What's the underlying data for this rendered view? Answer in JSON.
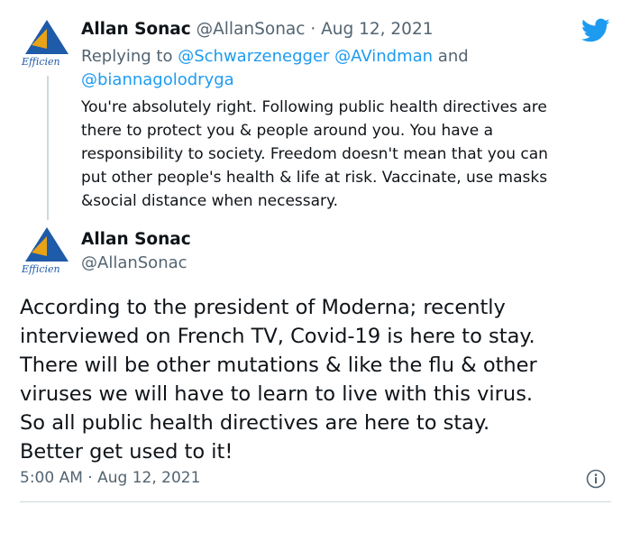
{
  "reply_tweet": {
    "author_name": "Allan Sonac",
    "handle": "@AllanSonac",
    "separator": "·",
    "date": "Aug 12, 2021",
    "replying_prefix": "Replying to",
    "mention_1": "@Schwarzenegger",
    "mention_2": "@AVindman",
    "and_word": "and",
    "mention_3": "@biannagolodryga",
    "text_lines": [
      "You're absolutely right. Following public health directives are",
      "there to protect you & people around you. You have a",
      "responsibility to society. Freedom doesn't mean that you can",
      "put other people's health & life at risk. Vaccinate, use masks",
      "&social distance when necessary."
    ]
  },
  "main_tweet": {
    "author_name": "Allan Sonac",
    "handle": "@AllanSonac",
    "text_lines": [
      "According to the president of Moderna; recently",
      "interviewed on French TV, Covid-19 is here to stay.",
      "There will be other mutations & like the flu & other",
      "viruses we will have to learn to live with this virus.",
      "So all public health directives are here to stay.",
      "Better get used to it!"
    ],
    "time": "5:00 AM",
    "separator": "·",
    "date": "Aug 12, 2021"
  },
  "avatar_logo_text": "Efficiency",
  "twitter_logo": "twitter-bird-icon",
  "info_icon": "info-icon",
  "colors": {
    "twitter_blue": "#1d9bf0",
    "logo_blue": "#1e5ba8",
    "logo_orange": "#e8a317",
    "muted": "#536471"
  }
}
